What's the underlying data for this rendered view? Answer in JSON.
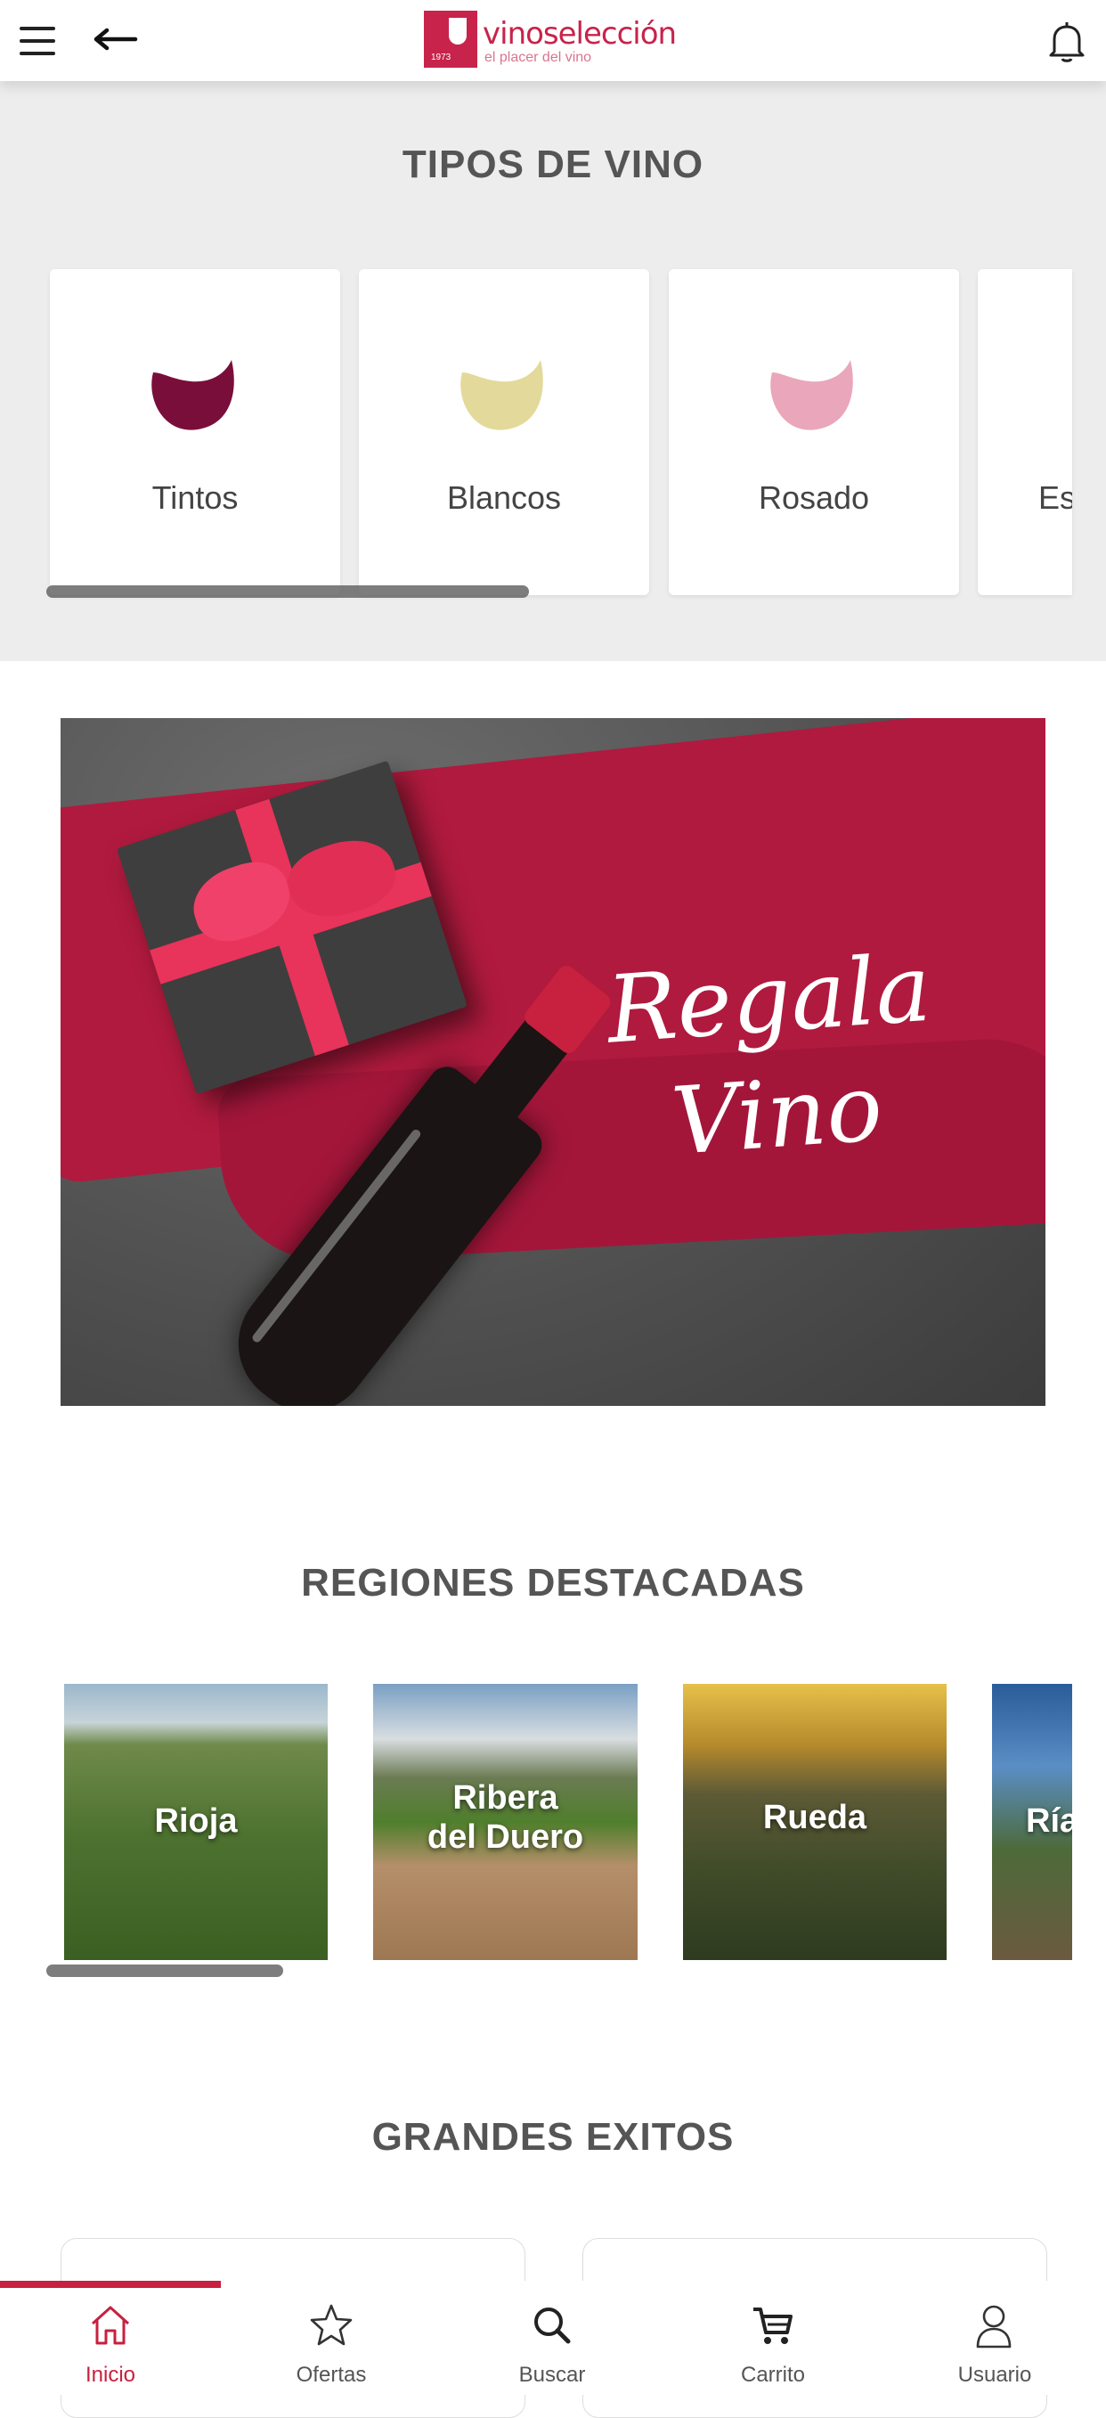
{
  "header": {
    "logo_name": "vinoselección",
    "logo_tagline": "el placer del vino",
    "logo_year": "1973"
  },
  "tipos": {
    "title": "TIPOS DE VINO",
    "items": [
      {
        "label": "Tintos",
        "color": "#7a0e3a"
      },
      {
        "label": "Blancos",
        "color": "#e3d99a"
      },
      {
        "label": "Rosado",
        "color": "#eaa6ba"
      },
      {
        "label": "Es",
        "color": "#cccccc"
      }
    ]
  },
  "banner": {
    "line1": "Regala",
    "line2": "Vino"
  },
  "regiones": {
    "title": "REGIONES DESTACADAS",
    "items": [
      {
        "label": "Rioja"
      },
      {
        "label": "Ribera del Duero",
        "label_line1": "Ribera",
        "label_line2": "del Duero"
      },
      {
        "label": "Rueda"
      },
      {
        "label": "Ría"
      }
    ]
  },
  "grandes_exitos": {
    "title": "GRANDES EXITOS"
  },
  "bottom_nav": {
    "active": "Inicio",
    "items": [
      {
        "label": "Inicio",
        "icon": "home-icon"
      },
      {
        "label": "Ofertas",
        "icon": "star-icon"
      },
      {
        "label": "Buscar",
        "icon": "search-icon"
      },
      {
        "label": "Carrito",
        "icon": "cart-icon"
      },
      {
        "label": "Usuario",
        "icon": "user-icon"
      }
    ]
  },
  "colors": {
    "brand": "#c8203f",
    "section_bg": "#ededed"
  }
}
